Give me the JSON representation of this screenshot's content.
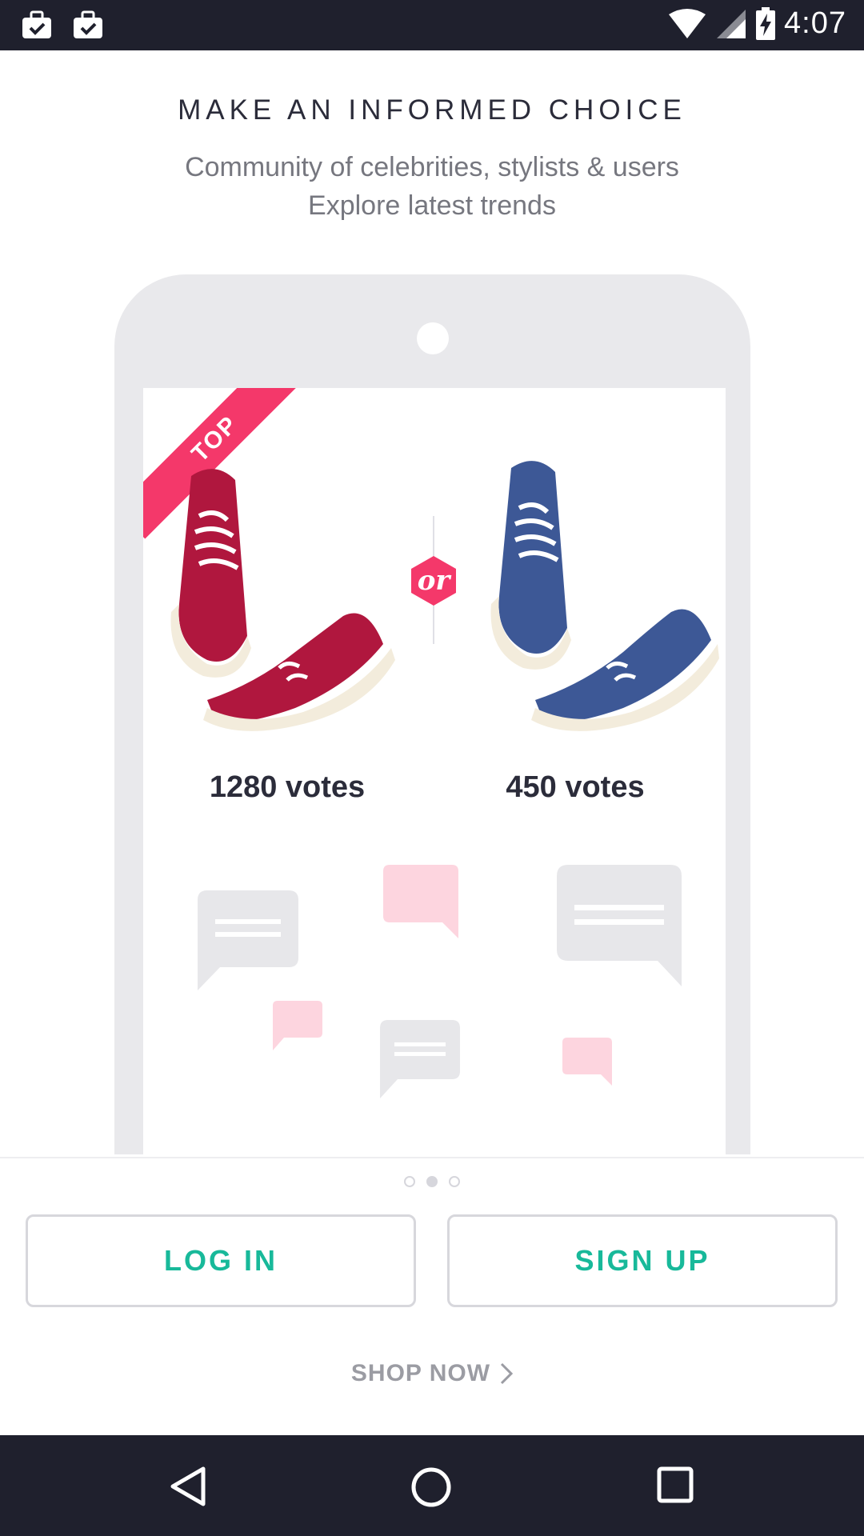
{
  "status_bar": {
    "time": "4:07",
    "icons": [
      "briefcase-check-icon",
      "briefcase-check-icon",
      "wifi-icon",
      "signal-icon",
      "battery-charging-icon"
    ]
  },
  "header": {
    "title": "MAKE AN INFORMED CHOICE",
    "subtitle_line1": "Community of celebrities, stylists & users",
    "subtitle_line2": "Explore latest trends"
  },
  "illustration": {
    "ribbon": "TOP",
    "or_label": "or",
    "left_votes": "1280 votes",
    "right_votes": "450 votes",
    "colors": {
      "accent": "#f4386a",
      "red_shoe": "#b0173e",
      "blue_shoe": "#3d5896"
    }
  },
  "pager": {
    "count": 3,
    "active_index": 1
  },
  "actions": {
    "login_label": "LOG IN",
    "signup_label": "SIGN UP",
    "shop_now_label": "SHOP NOW",
    "accent_color": "#18b99a"
  },
  "nav_bar": {
    "icons": [
      "back-icon",
      "home-icon",
      "recents-icon"
    ]
  }
}
